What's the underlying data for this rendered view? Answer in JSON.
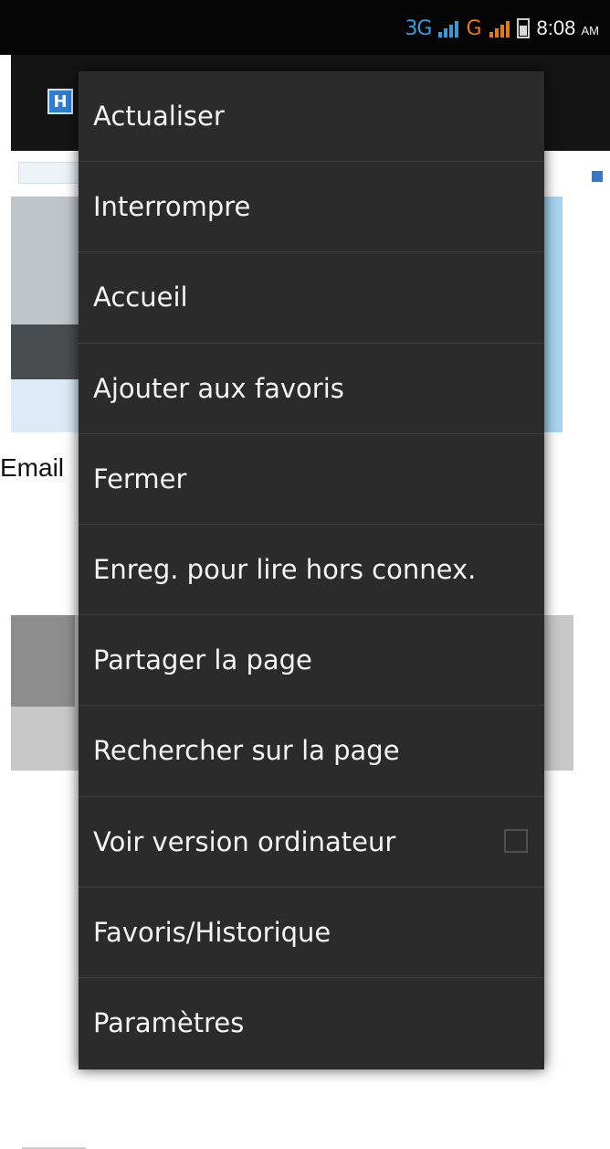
{
  "status_bar": {
    "network_3g": "3G",
    "network_g": "G",
    "time": "8:08",
    "ampm": "AM",
    "icons": [
      "signal-3g-icon",
      "signal-g-icon",
      "battery-icon"
    ]
  },
  "browser": {
    "app_icon_letter": "H"
  },
  "page": {
    "email_label": "Email"
  },
  "menu": {
    "items": [
      {
        "label": "Actualiser"
      },
      {
        "label": "Interrompre"
      },
      {
        "label": "Accueil"
      },
      {
        "label": "Ajouter aux favoris"
      },
      {
        "label": "Fermer"
      },
      {
        "label": "Enreg. pour lire hors connex."
      },
      {
        "label": "Partager la page"
      },
      {
        "label": "Rechercher sur la page"
      },
      {
        "label": "Voir version ordinateur",
        "checkbox": false
      },
      {
        "label": "Favoris/Historique"
      },
      {
        "label": "Paramètres"
      }
    ]
  },
  "colors": {
    "menu_bg": "#2b2b2b",
    "status_bar_bg": "#050505",
    "accent_blue": "#3a9ad8",
    "accent_orange": "#e07a1a"
  }
}
